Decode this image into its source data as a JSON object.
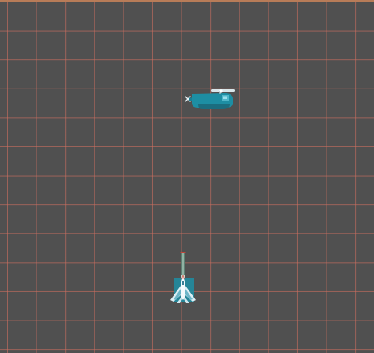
{
  "scene": {
    "background_color": "#505050",
    "grid_line_color": "#cd6e5f",
    "top_border_color": "#b87c58"
  },
  "sprites": {
    "enemy": {
      "icon": "helicopter-icon",
      "color": "#1d8ea3"
    },
    "player": {
      "icon": "fighter-jet-icon",
      "color": "#1d8ea3"
    },
    "projectile": {
      "icon": "laser-bullet-icon",
      "color": "#c0453a"
    }
  }
}
